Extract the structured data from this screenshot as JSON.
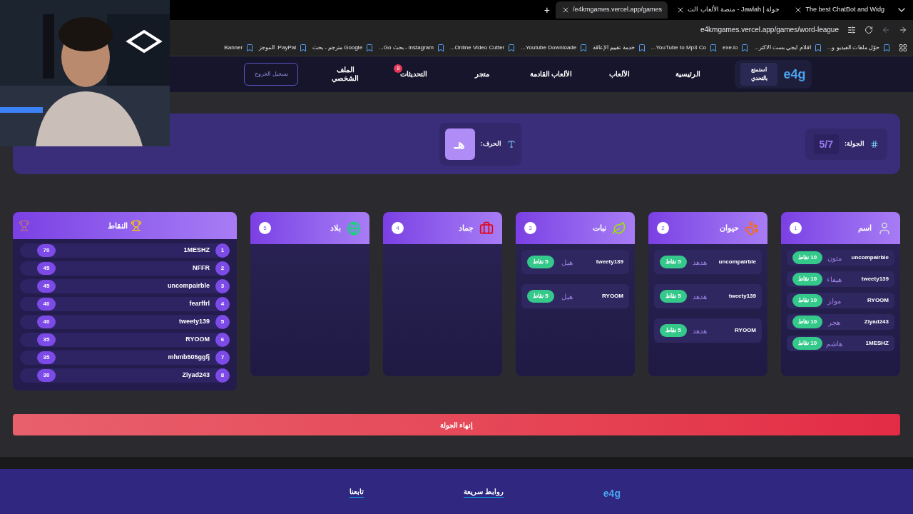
{
  "browser": {
    "tabs": [
      {
        "title": "The best ChatBot and Widg",
        "selected": false
      },
      {
        "title": "جولة | Jawlah - منصة الألعاب الت",
        "selected": false
      },
      {
        "title": "e4kmgames.vercel.app/games/",
        "selected": true
      }
    ],
    "new_tab": "+",
    "url": "e4kmgames.vercel.app/games/word-league",
    "bookmarks": [
      "حوّل ملفات الفيديو و...",
      "افلام ايجي بست الاكثر...",
      "exe.io",
      "YouTube to Mp3 Co...",
      "خدمة تقييم الإعاقة",
      "Youtube Downloade...",
      "Online Video Cutter...",
      "instagram - بحث Go...",
      "Google مترجم - بحث",
      "PayPal: الموجز",
      "Banner"
    ]
  },
  "nav": {
    "logo": "e4g",
    "tagline": "استمتع بالتحدي",
    "links": [
      {
        "label": "الرئيسية"
      },
      {
        "label": "الألعاب"
      },
      {
        "label": "الألعاب القادمة"
      },
      {
        "label": "متجر"
      },
      {
        "label": "التحديثات",
        "badge": "8"
      },
      {
        "label": "الملف الشخصي"
      }
    ],
    "logout": "تسجيل الخروج"
  },
  "round": {
    "label": "الجولة:",
    "value": "5/7"
  },
  "letter": {
    "label": "الحرف:",
    "value": "هـ"
  },
  "categories": [
    {
      "title": "اسم",
      "number": "1",
      "entries": [
        {
          "player": "uncompairble",
          "word": "متون",
          "points": "10 نقاط"
        },
        {
          "player": "tweety139",
          "word": "هيفاء",
          "points": "10 نقاط"
        },
        {
          "player": "RYOOM",
          "word": "مولز",
          "points": "10 نقاط"
        },
        {
          "player": "Ziyad243",
          "word": "هجر",
          "points": "10 نقاط"
        },
        {
          "player": "1MESHZ",
          "word": "هاشم",
          "points": "10 نقاط"
        }
      ]
    },
    {
      "title": "حيوان",
      "number": "2",
      "entries": [
        {
          "player": "uncompairble",
          "word": "هدهد",
          "points": "5 نقاط"
        },
        {
          "player": "tweety139",
          "word": "هدهد",
          "points": "5 نقاط"
        },
        {
          "player": "RYOOM",
          "word": "هدهد",
          "points": "5 نقاط"
        }
      ]
    },
    {
      "title": "نبات",
      "number": "3",
      "entries": [
        {
          "player": "tweety139",
          "word": "هيل",
          "points": "5 نقاط"
        },
        {
          "player": "RYOOM",
          "word": "هيل",
          "points": "5 نقاط"
        }
      ]
    },
    {
      "title": "جماد",
      "number": "4"
    },
    {
      "title": "بلاد",
      "number": "5"
    }
  ],
  "leaderboard": {
    "title": "النقاط",
    "rows": [
      {
        "rank": "1",
        "name": "1MESHZ",
        "score": "70"
      },
      {
        "rank": "2",
        "name": "NFFR",
        "score": "45"
      },
      {
        "rank": "3",
        "name": "uncompairble",
        "score": "45"
      },
      {
        "rank": "4",
        "name": "fearffrl",
        "score": "40"
      },
      {
        "rank": "5",
        "name": "tweety139",
        "score": "40"
      },
      {
        "rank": "6",
        "name": "RYOOM",
        "score": "35"
      },
      {
        "rank": "7",
        "name": "mhmb505ggfj",
        "score": "35"
      },
      {
        "rank": "8",
        "name": "Ziyad243",
        "score": "30"
      }
    ]
  },
  "end_button": "إنهاء الجولة",
  "footer": {
    "logo": "e4g",
    "headings": [
      "روابط سريعة",
      "تابعنا"
    ]
  }
}
